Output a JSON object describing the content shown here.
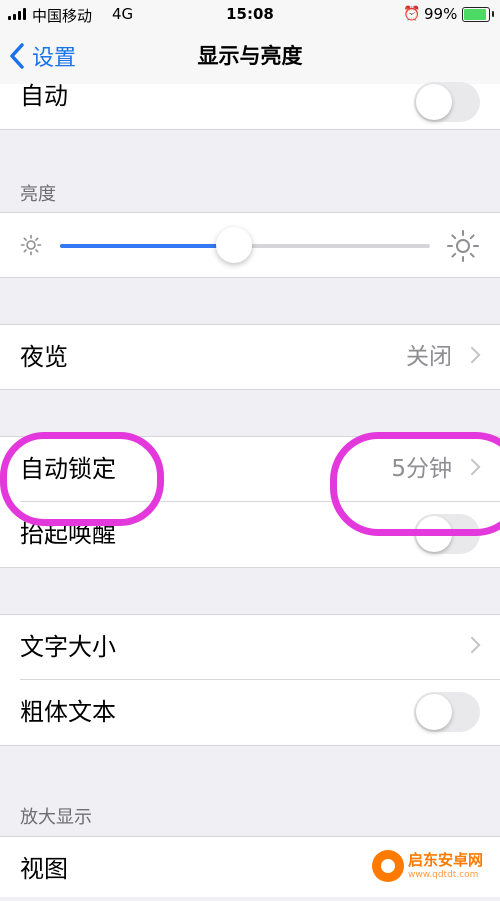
{
  "status_bar": {
    "carrier": "中国移动",
    "network": "4G",
    "time": "15:08",
    "battery_pct": "99%",
    "battery_level": 0.99
  },
  "nav": {
    "back_label": "设置",
    "title": "显示与亮度"
  },
  "appearance": {
    "auto_label": "自动",
    "auto_on": false
  },
  "brightness": {
    "header": "亮度",
    "level": 0.47
  },
  "night_shift": {
    "label": "夜览",
    "value": "关闭"
  },
  "lock": {
    "auto_lock_label": "自动锁定",
    "auto_lock_value": "5分钟",
    "raise_to_wake_label": "抬起唤醒",
    "raise_to_wake_on": false
  },
  "text": {
    "text_size_label": "文字大小",
    "bold_text_label": "粗体文本",
    "bold_text_on": false
  },
  "zoom": {
    "header": "放大显示",
    "view_label": "视图"
  },
  "watermark": {
    "brand": "启东安卓网",
    "url": "www.qdtdt.com"
  },
  "colors": {
    "accent": "#3478f6",
    "annotation": "#e339dc",
    "background": "#efeff4"
  }
}
